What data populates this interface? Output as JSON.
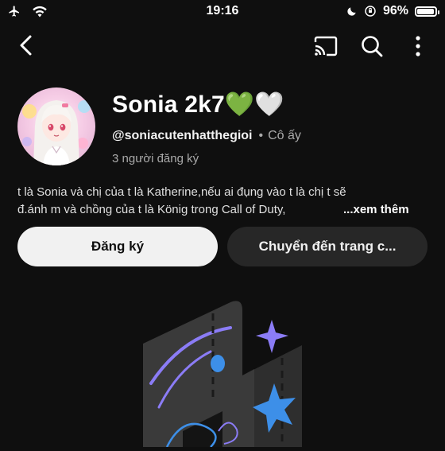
{
  "status_bar": {
    "time": "19:16",
    "battery_percent": "96%",
    "battery_level": 0.96,
    "left_icons": [
      "airplane-icon",
      "wifi-icon"
    ],
    "right_icons": [
      "moon-icon",
      "orientation-lock-icon",
      "battery-icon"
    ]
  },
  "toolbar": {
    "back_icon": "back-chevron-icon",
    "actions": [
      "cast-icon",
      "search-icon",
      "more-vert-icon"
    ]
  },
  "profile": {
    "name": "Sonia 2k7💚🤍",
    "handle": "@soniacutenhatthegioi",
    "separator": "•",
    "pronoun": "Cô ấy",
    "subscribers": "3 người đăng ký",
    "bio_line1": "t là Sonia và chị của t là Katherine,nếu ai đụng vào t là chị t sẽ",
    "bio_line2": "đ.ánh m và chồng của t là König trong Call of Duty, ",
    "bio_more": "...xem thêm"
  },
  "buttons": {
    "subscribe": "Đăng ký",
    "channel": "Chuyển đến trang c..."
  },
  "colors": {
    "background": "#0f0f0f",
    "primary_button": "#f1f1f1",
    "secondary_button": "#272727",
    "muted_text": "#aaaaaa",
    "accent_purple": "#8b7cf6",
    "accent_blue": "#3d8fe8"
  }
}
